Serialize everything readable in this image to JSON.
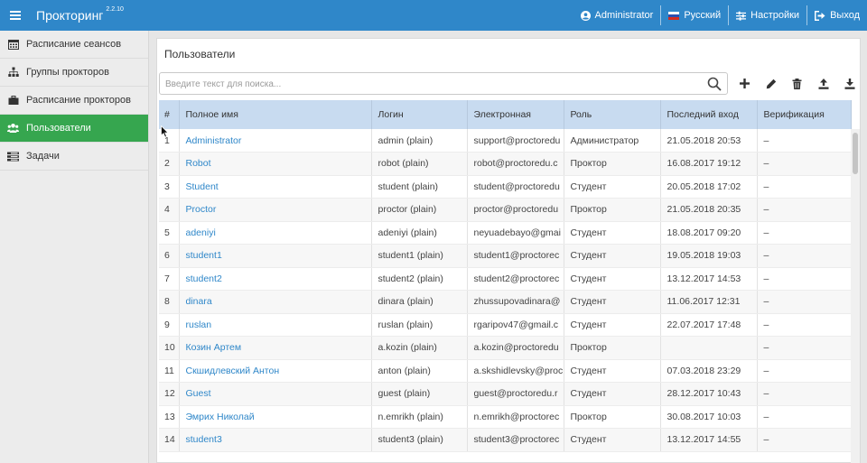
{
  "header": {
    "app_title": "Прокторинг",
    "version": "2.2.10",
    "user": "Administrator",
    "language": "Русский",
    "settings": "Настройки",
    "logout": "Выход"
  },
  "sidebar": {
    "items": [
      {
        "label": "Расписание сеансов",
        "icon": "calendar-icon"
      },
      {
        "label": "Группы прокторов",
        "icon": "sitemap-icon"
      },
      {
        "label": "Расписание прокторов",
        "icon": "briefcase-icon"
      },
      {
        "label": "Пользователи",
        "icon": "users-icon",
        "active": true
      },
      {
        "label": "Задачи",
        "icon": "tasks-icon"
      }
    ]
  },
  "main": {
    "title": "Пользователи",
    "search_placeholder": "Введите текст для поиска...",
    "table": {
      "columns": [
        "#",
        "Полное имя",
        "Логин",
        "Электронная",
        "Роль",
        "Последний вход",
        "Верификация"
      ],
      "rows": [
        [
          "1",
          "Administrator",
          "admin (plain)",
          "support@proctoredu",
          "Администратор",
          "21.05.2018 20:53",
          "–"
        ],
        [
          "2",
          "Robot",
          "robot (plain)",
          "robot@proctoredu.c",
          "Проктор",
          "16.08.2017 19:12",
          "–"
        ],
        [
          "3",
          "Student",
          "student (plain)",
          "student@proctoredu",
          "Студент",
          "20.05.2018 17:02",
          "–"
        ],
        [
          "4",
          "Proctor",
          "proctor (plain)",
          "proctor@proctoredu",
          "Проктор",
          "21.05.2018 20:35",
          "–"
        ],
        [
          "5",
          "adeniyi",
          "adeniyi (plain)",
          "neyuadebayo@gmai",
          "Студент",
          "18.08.2017 09:20",
          "–"
        ],
        [
          "6",
          "student1",
          "student1 (plain)",
          "student1@proctorec",
          "Студент",
          "19.05.2018 19:03",
          "–"
        ],
        [
          "7",
          "student2",
          "student2 (plain)",
          "student2@proctorec",
          "Студент",
          "13.12.2017 14:53",
          "–"
        ],
        [
          "8",
          "dinara",
          "dinara (plain)",
          "zhussupovadinara@",
          "Студент",
          "11.06.2017 12:31",
          "–"
        ],
        [
          "9",
          "ruslan",
          "ruslan (plain)",
          "rgaripov47@gmail.c",
          "Студент",
          "22.07.2017 17:48",
          "–"
        ],
        [
          "10",
          "Козин Артем",
          "a.kozin (plain)",
          "a.kozin@proctoredu",
          "Проктор",
          "",
          "–"
        ],
        [
          "11",
          "Скшидлевский Антон",
          "anton (plain)",
          "a.skshidlevsky@proc",
          "Студент",
          "07.03.2018 23:29",
          "–"
        ],
        [
          "12",
          "Guest",
          "guest (plain)",
          "guest@proctoredu.r",
          "Студент",
          "28.12.2017 10:43",
          "–"
        ],
        [
          "13",
          "Эмрих Николай",
          "n.emrikh (plain)",
          "n.emrikh@proctorec",
          "Проктор",
          "30.08.2017 10:03",
          "–"
        ],
        [
          "14",
          "student3",
          "student3 (plain)",
          "student3@proctorec",
          "Студент",
          "13.12.2017 14:55",
          "–"
        ]
      ]
    }
  },
  "colors": {
    "topbar": "#2f87c9",
    "active_sidebar": "#36a64f",
    "table_header": "#c8dbf0",
    "link": "#2f87c9"
  }
}
